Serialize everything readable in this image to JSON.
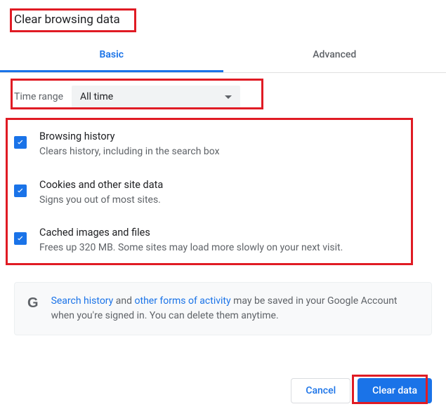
{
  "title": "Clear browsing data",
  "tabs": {
    "basic": "Basic",
    "advanced": "Advanced"
  },
  "timerange": {
    "label": "Time range",
    "value": "All time"
  },
  "options": [
    {
      "title": "Browsing history",
      "desc": "Clears history, including in the search box"
    },
    {
      "title": "Cookies and other site data",
      "desc": "Signs you out of most sites."
    },
    {
      "title": "Cached images and files",
      "desc": "Frees up 320 MB. Some sites may load more slowly on your next visit."
    }
  ],
  "info": {
    "link1": "Search history",
    "mid1": " and ",
    "link2": "other forms of activity",
    "rest": " may be saved in your Google Account when you're signed in. You can delete them anytime."
  },
  "buttons": {
    "cancel": "Cancel",
    "clear": "Clear data"
  }
}
